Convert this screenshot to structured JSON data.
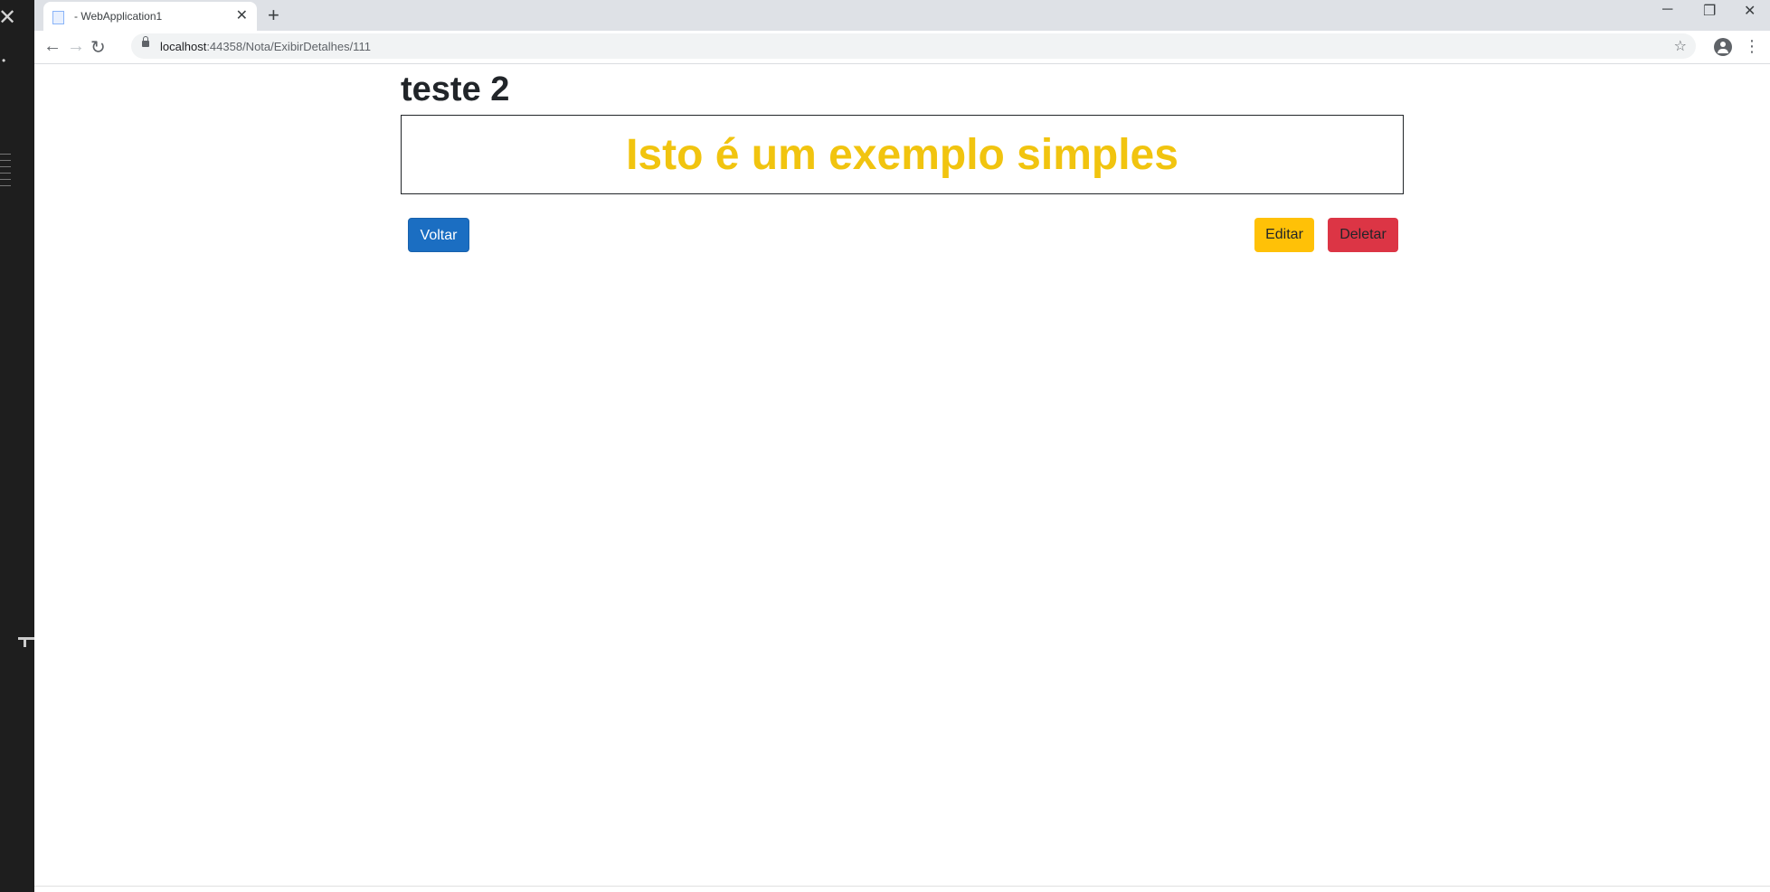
{
  "browser": {
    "tab_title": "- WebApplication1",
    "url_host": "localhost",
    "url_rest": ":44358/Nota/ExibirDetalhes/111"
  },
  "icons": {
    "new_tab": "plus-icon",
    "back": "arrow-left-icon",
    "forward": "arrow-right-icon",
    "reload": "reload-icon",
    "lock": "lock-icon",
    "bookmark": "star-icon",
    "profile": "account-icon",
    "menu": "kebab-menu-icon"
  },
  "page": {
    "title": "teste 2",
    "note_text": "Isto é um exemplo simples",
    "buttons": {
      "back": "Voltar",
      "edit": "Editar",
      "delete": "Deletar"
    }
  },
  "colors": {
    "note_text": "#f1c40f",
    "primary": "#1b6ec2",
    "warning": "#ffc107",
    "danger": "#dc3545"
  }
}
